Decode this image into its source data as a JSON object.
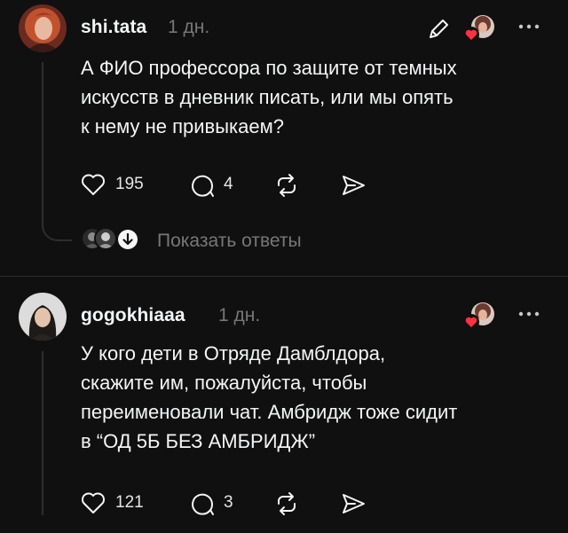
{
  "posts": [
    {
      "username": "shi.tata",
      "time": "1 дн.",
      "text_lines": [
        "А ФИО профессора по защите от темных",
        "искусств в дневник писать, или мы опять",
        "к нему не привыкаем?"
      ],
      "likes": "195",
      "comments": "4",
      "show_replies": "Показать ответы",
      "icons": {
        "avatar": "avatar-red-hair",
        "edit": "pencil-icon",
        "like": "heart-icon",
        "comment": "comment-icon",
        "repost": "repost-icon",
        "share": "send-icon",
        "more": "more-icon"
      }
    },
    {
      "username": "gogokhiaaa",
      "time": "1 дн.",
      "text_lines": [
        "У кого дети в Отряде Дамблдора,",
        "скажите им, пожалуйста, чтобы",
        "переименовали чат. Амбридж тоже сидит",
        "в “ОД 5Б БЕЗ АМБРИДЖ”"
      ],
      "likes": "121",
      "comments": "3",
      "icons": {
        "avatar": "avatar-dark-hair",
        "like": "heart-icon",
        "comment": "comment-icon",
        "repost": "repost-icon",
        "share": "send-icon",
        "more": "more-icon"
      }
    }
  ],
  "colors": {
    "background": "#101010",
    "primary_text": "#f3f5f7",
    "secondary_text": "#777777",
    "like_heart": "#ff3040",
    "divider": "#2c2c2c"
  }
}
